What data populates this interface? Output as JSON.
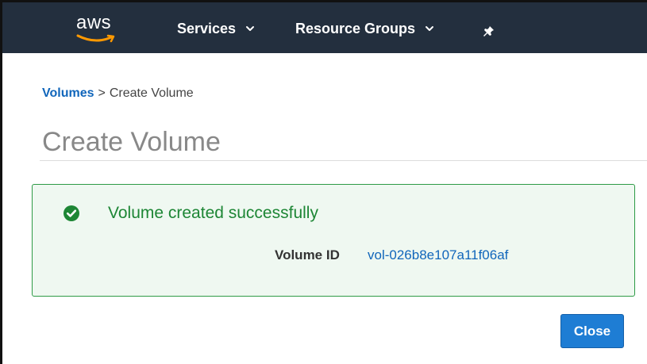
{
  "topnav": {
    "logo_text": "aws",
    "items": [
      {
        "label": "Services",
        "icon": "chevron-down-icon"
      },
      {
        "label": "Resource Groups",
        "icon": "chevron-down-icon"
      }
    ],
    "pin_icon": "pin-icon",
    "background_color": "#232f3e",
    "logo_smile_color": "#ff9900"
  },
  "breadcrumb": {
    "parent": "Volumes",
    "separator": ">",
    "current": "Create Volume"
  },
  "page": {
    "title": "Create Volume"
  },
  "success_panel": {
    "icon": "check-circle-icon",
    "message": "Volume created successfully",
    "volume_id_label": "Volume ID",
    "volume_id_value": "vol-026b8e107a11f06af",
    "border_color": "#2d9b46",
    "text_color": "#1d8635"
  },
  "actions": {
    "close_label": "Close",
    "close_color": "#1e7dd4"
  }
}
